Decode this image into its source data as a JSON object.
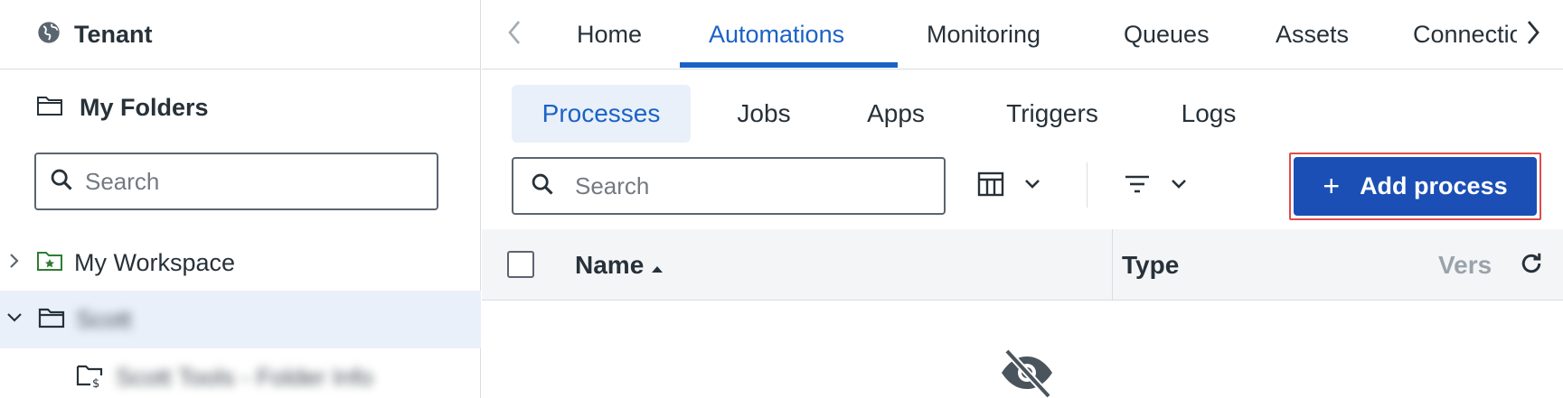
{
  "sidebar": {
    "tenant_label": "Tenant",
    "my_folders_label": "My Folders",
    "search": {
      "placeholder": "Search",
      "value": ""
    },
    "tree": [
      {
        "label": "My Workspace",
        "expanded": false
      },
      {
        "label": "Scott",
        "expanded": true,
        "selected": true
      },
      {
        "label": "Scott Tools - Folder Info"
      }
    ]
  },
  "topnav": {
    "tabs": [
      {
        "label": "Home"
      },
      {
        "label": "Automations",
        "active": true
      },
      {
        "label": "Monitoring"
      },
      {
        "label": "Queues"
      },
      {
        "label": "Assets"
      },
      {
        "label": "Connections"
      }
    ]
  },
  "subtabs": [
    {
      "label": "Processes",
      "active": true
    },
    {
      "label": "Jobs"
    },
    {
      "label": "Apps"
    },
    {
      "label": "Triggers"
    },
    {
      "label": "Logs"
    }
  ],
  "toolbar": {
    "search": {
      "placeholder": "Search",
      "value": ""
    },
    "add_button_label": "Add process"
  },
  "table": {
    "columns": [
      {
        "label": "Name",
        "sort": "ascending"
      },
      {
        "label": "Type"
      },
      {
        "label": "Version"
      }
    ]
  },
  "colors": {
    "accent": "#1b62c6",
    "primary_button": "#1b4fb5",
    "highlight_outline": "#e14b4b",
    "selected_row": "#e9f0fa"
  }
}
